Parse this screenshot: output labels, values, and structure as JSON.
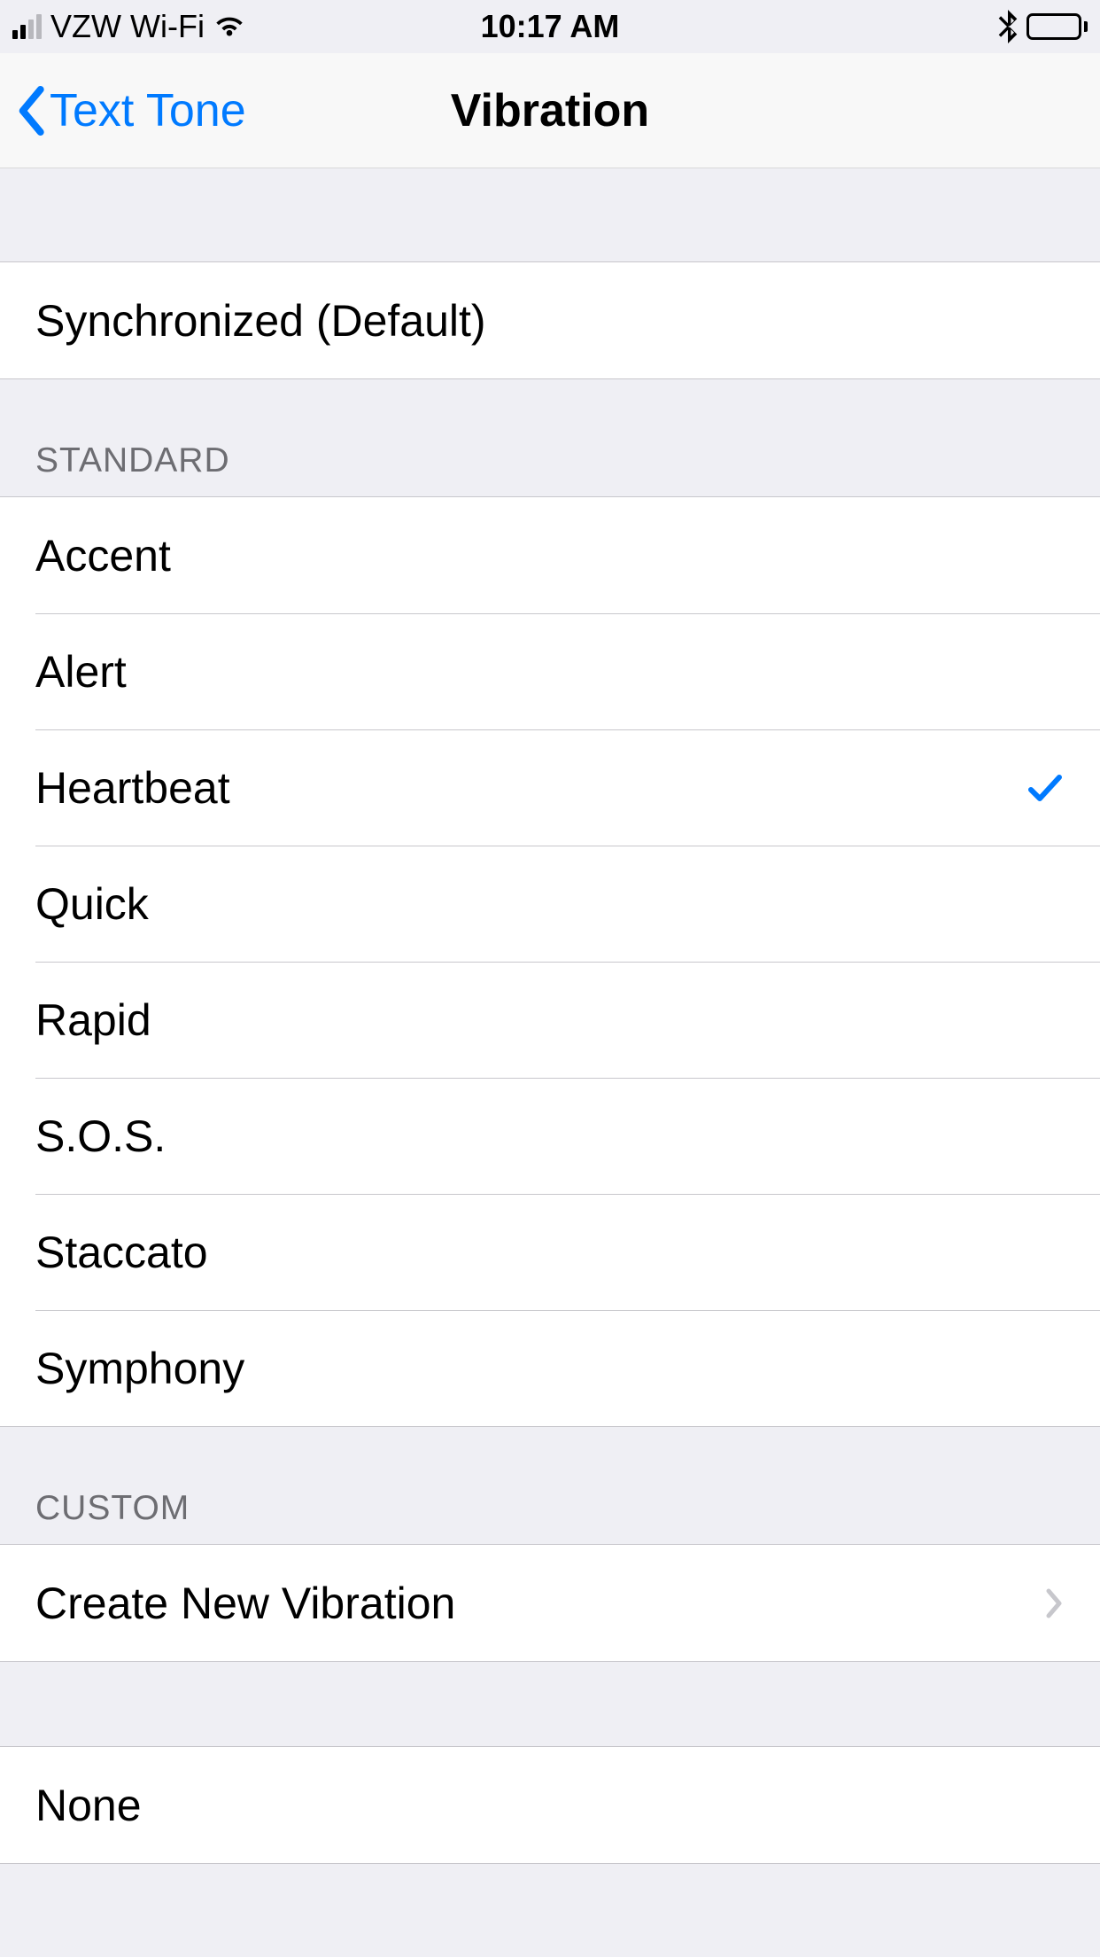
{
  "status": {
    "carrier": "VZW Wi-Fi",
    "time": "10:17 AM"
  },
  "nav": {
    "back_label": "Text Tone",
    "title": "Vibration"
  },
  "sections": {
    "default_option": "Synchronized (Default)",
    "standard_header": "STANDARD",
    "standard": [
      {
        "label": "Accent",
        "selected": false
      },
      {
        "label": "Alert",
        "selected": false
      },
      {
        "label": "Heartbeat",
        "selected": true
      },
      {
        "label": "Quick",
        "selected": false
      },
      {
        "label": "Rapid",
        "selected": false
      },
      {
        "label": "S.O.S.",
        "selected": false
      },
      {
        "label": "Staccato",
        "selected": false
      },
      {
        "label": "Symphony",
        "selected": false
      }
    ],
    "custom_header": "CUSTOM",
    "create_label": "Create New Vibration",
    "none_label": "None"
  }
}
